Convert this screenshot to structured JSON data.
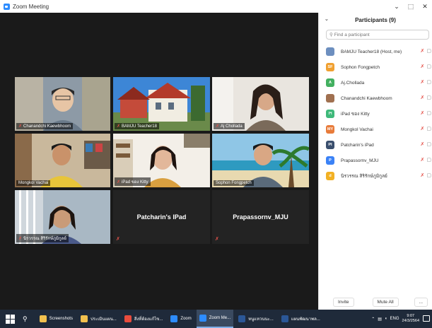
{
  "window": {
    "title": "Zoom Meeting",
    "controls": [
      "⌄",
      "⬚",
      "✕"
    ]
  },
  "video": {
    "tiles": [
      {
        "name": "Chanandchi Kaewbhoom"
      },
      {
        "name": "BAMJU Teacher18"
      },
      {
        "name": "Aj Chollada"
      },
      {
        "name": "Mongkol Vachai"
      },
      {
        "name": "iPad ของ Kitty"
      },
      {
        "name": "Sophon Fongpetch"
      },
      {
        "name": "นิรวรรณ สิริรักษ์ภูมิกูลย์"
      },
      {
        "name": "Patcharin's IPad"
      },
      {
        "name": "Prapassornv_MJU"
      }
    ]
  },
  "panel": {
    "title": "Participants (9)",
    "search_placeholder": "Find a participant",
    "participants": [
      {
        "initials": "",
        "name": "BAMJU Teacher18 (Host, me)",
        "color": "#6d8fbf"
      },
      {
        "initials": "SF",
        "name": "Sophon Fongpetch",
        "color": "#f0a030"
      },
      {
        "initials": "A",
        "name": "Aj.Chollada",
        "color": "#43b060"
      },
      {
        "initials": "",
        "name": "Chanandchi Kaewbhoom",
        "color": "#a07050"
      },
      {
        "initials": "Iฯ",
        "name": "iPad ของ Kitty",
        "color": "#3fb97a"
      },
      {
        "initials": "MY",
        "name": "Mongkol Vachai",
        "color": "#e87b3a"
      },
      {
        "initials": "PI",
        "name": "Patcharin's iPad",
        "color": "#3a4f6e"
      },
      {
        "initials": "P",
        "name": "Prapassornv_MJU",
        "color": "#3b82f6"
      },
      {
        "initials": "d",
        "name": "นิรวรรณ สิริรักษ์ภูมิกูลย์",
        "color": "#f2b124"
      }
    ],
    "invite_label": "Invite",
    "mute_all_label": "Mute All",
    "more_label": "..."
  },
  "taskbar": {
    "items": [
      {
        "label": "Screenshots",
        "color": "#f2c14e"
      },
      {
        "label": "ประเมินแผน...",
        "color": "#f2c14e"
      },
      {
        "label": "สิ่งที่ต้องแก้ไข...",
        "color": "#e94c3d"
      },
      {
        "label": "Zoom",
        "color": "#2d8cff"
      },
      {
        "label": "Zoom Me...",
        "color": "#2d8cff"
      },
      {
        "label": "หนูแหวนนะ...",
        "color": "#2b5797"
      },
      {
        "label": "แผนพัฒนาพล...",
        "color": "#2b5797"
      }
    ],
    "tray_lang": "ENG",
    "time": "9:07",
    "date": "24/3/2564"
  }
}
